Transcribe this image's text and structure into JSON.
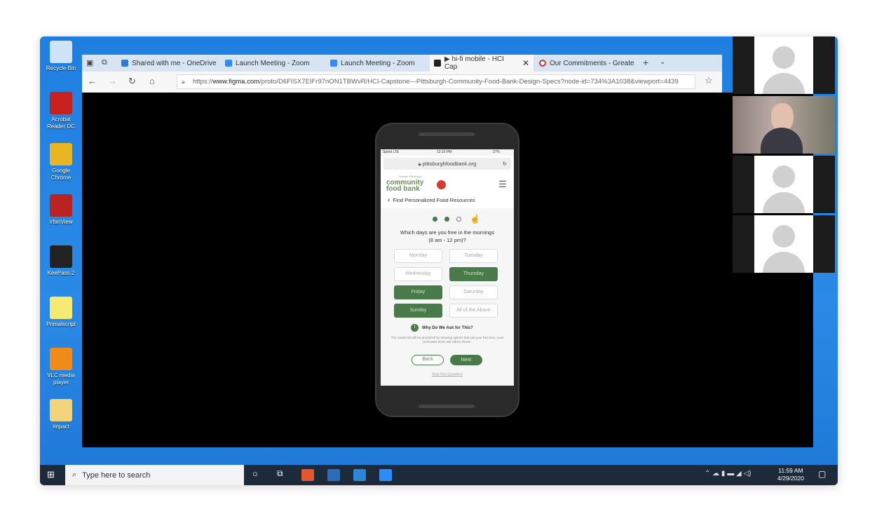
{
  "desktop": {
    "icons": [
      {
        "label": "Recycle Bin",
        "name": "recycle-bin",
        "color": "#cfe3f7"
      },
      {
        "label": "Acrobat Reader DC",
        "name": "acrobat",
        "color": "#c8201c"
      },
      {
        "label": "Google Chrome",
        "name": "chrome",
        "color": "#e9b523"
      },
      {
        "label": "IrfanView",
        "name": "irfanview",
        "color": "#b22"
      },
      {
        "label": "KeePass 2",
        "name": "keepass",
        "color": "#222"
      },
      {
        "label": "Primalscript",
        "name": "primalscript",
        "color": "#f4ea74"
      },
      {
        "label": "VLC media player",
        "name": "vlc",
        "color": "#f08a18"
      },
      {
        "label": "Impact",
        "name": "impact",
        "color": "#f2d27a"
      }
    ]
  },
  "browser": {
    "tabs": [
      {
        "label": "Shared with me - OneDrive"
      },
      {
        "label": "Launch Meeting - Zoom"
      },
      {
        "label": "Launch Meeting - Zoom"
      },
      {
        "label": "▶ hi-fi mobile - HCI Cap",
        "active": true
      },
      {
        "label": "Our Commitments - Greate"
      }
    ],
    "url_prefix": "https://",
    "url_domain": "www.figma.com",
    "url_rest": "/proto/D6FISX7EIFr97nON1TBWvR/HCI-Capstone---Pittsburgh-Community-Food-Bank-Design-Specs?node-id=734%3A1038&viewport=4439"
  },
  "phone": {
    "status": {
      "carrier": "Sprint LTE",
      "time": "12:15 PM",
      "battery": "27%"
    },
    "address": "pittsburghfoodbank.org",
    "logo_small": "Greater Pittsburgh",
    "logo_line1": "community",
    "logo_line2": "food bank",
    "page_title": "Find Personalized Food Resources",
    "progress": {
      "current": 2,
      "total": 3
    },
    "question": "Which days are you free in the mornings",
    "question_sub": "(8 am - 12 pm)?",
    "days": [
      {
        "label": "Monday",
        "selected": false
      },
      {
        "label": "Tuesday",
        "selected": false
      },
      {
        "label": "Wednesday",
        "selected": false
      },
      {
        "label": "Thursday",
        "selected": true
      },
      {
        "label": "Friday",
        "selected": true
      },
      {
        "label": "Saturday",
        "selected": false
      },
      {
        "label": "Sunday",
        "selected": true
      },
      {
        "label": "All of the Above",
        "selected": false
      }
    ],
    "why_title": "Why Do We Ask for This?",
    "why_text": "The results list will be prioritized by showing options that suit your free time. Less preferable times will still be shown.",
    "back": "Back",
    "next": "Next",
    "skip": "Skip this Question",
    "accent": "#4a7a4a"
  },
  "taskbar": {
    "search_placeholder": "Type here to search",
    "time": "11:59 AM",
    "date": "4/29/2020"
  }
}
